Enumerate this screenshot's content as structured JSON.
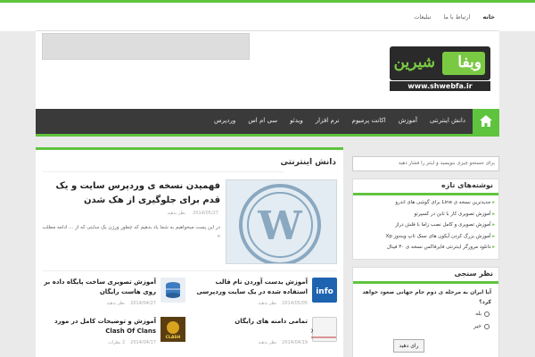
{
  "topbar": {
    "home": "خانه",
    "links": [
      "ارتباط با ما",
      "تبلیغات"
    ]
  },
  "header": {
    "logo_text_fa_right": "وبفا",
    "logo_text_fa_left": "شیرین",
    "logo_url": "www.shwebfa.ir"
  },
  "nav": {
    "items": [
      "دانش اینترنتی",
      "آموزش",
      "اکانت پرمیوم",
      "نرم افزار",
      "ویدئو",
      "سی ام اس",
      "وردپرس"
    ]
  },
  "main": {
    "section_title": "دانش اینترنتی",
    "featured": {
      "title": "فهمیدن نسخه ی وردپرس سایت و یک قدم برای جلوگیری از هک شدن",
      "date": "2014/05/27",
      "comments": "نظر بدهید",
      "excerpt": "در این پست میخواهیم به شما یاد بدهیم که چطور ورژن یک سایتی که از ... ادامه مطلب »"
    },
    "cards": [
      {
        "title": "آموزش بدست آوردن نام قالب استفاده شده در یک سایت وردپرسی",
        "date": "2014/05/05",
        "comments": "نظر بدهید",
        "thumb": "info-icon"
      },
      {
        "title": "آموزش تصویری ساخت پایگاه داده بر روی هاست رایگان",
        "date": "2014/04/27",
        "comments": "نظر بدهید",
        "thumb": "database-icon"
      },
      {
        "title": "تمامی دامنه های رایگان",
        "date": "2014/04/19",
        "comments": "نظر بدهید",
        "thumb": "http-icon"
      },
      {
        "title": "آموزش و توضیحات کامل در مورد Clash Of Clans",
        "date": "2014/04/17",
        "comments": "2 نظرات",
        "thumb": "clash-icon"
      }
    ]
  },
  "sidebar": {
    "search_placeholder": "برای جستجو چیزی بنویسید و اینتر را فشار دهید",
    "recent_title": "نوشته‌های تازه",
    "recent": [
      "جدیدترین نسخه ی Line برای گوشی های اندرو",
      "آموزش تصویری کار با تابن در کسپرتو",
      "آموزش تصویری و کامل نصب زاما با فلش دراز",
      "آموزش بزرگ کردن آیکون های نسک تاپ ویندوز Xp",
      "دانلود مرورگر اینترنتی فایرفاکس نسخه ی ۳۰ فینال"
    ],
    "poll_title": "نظر سنجی",
    "poll_question": "آیا ایران به مرحله ی دوم جام جهانی صعود خواهد کرد؟",
    "poll_options": [
      "بله",
      "خیر"
    ],
    "vote_label": "رای دهید"
  },
  "colors": {
    "accent": "#5fc43d",
    "nav_bg": "#3a3a3a"
  }
}
